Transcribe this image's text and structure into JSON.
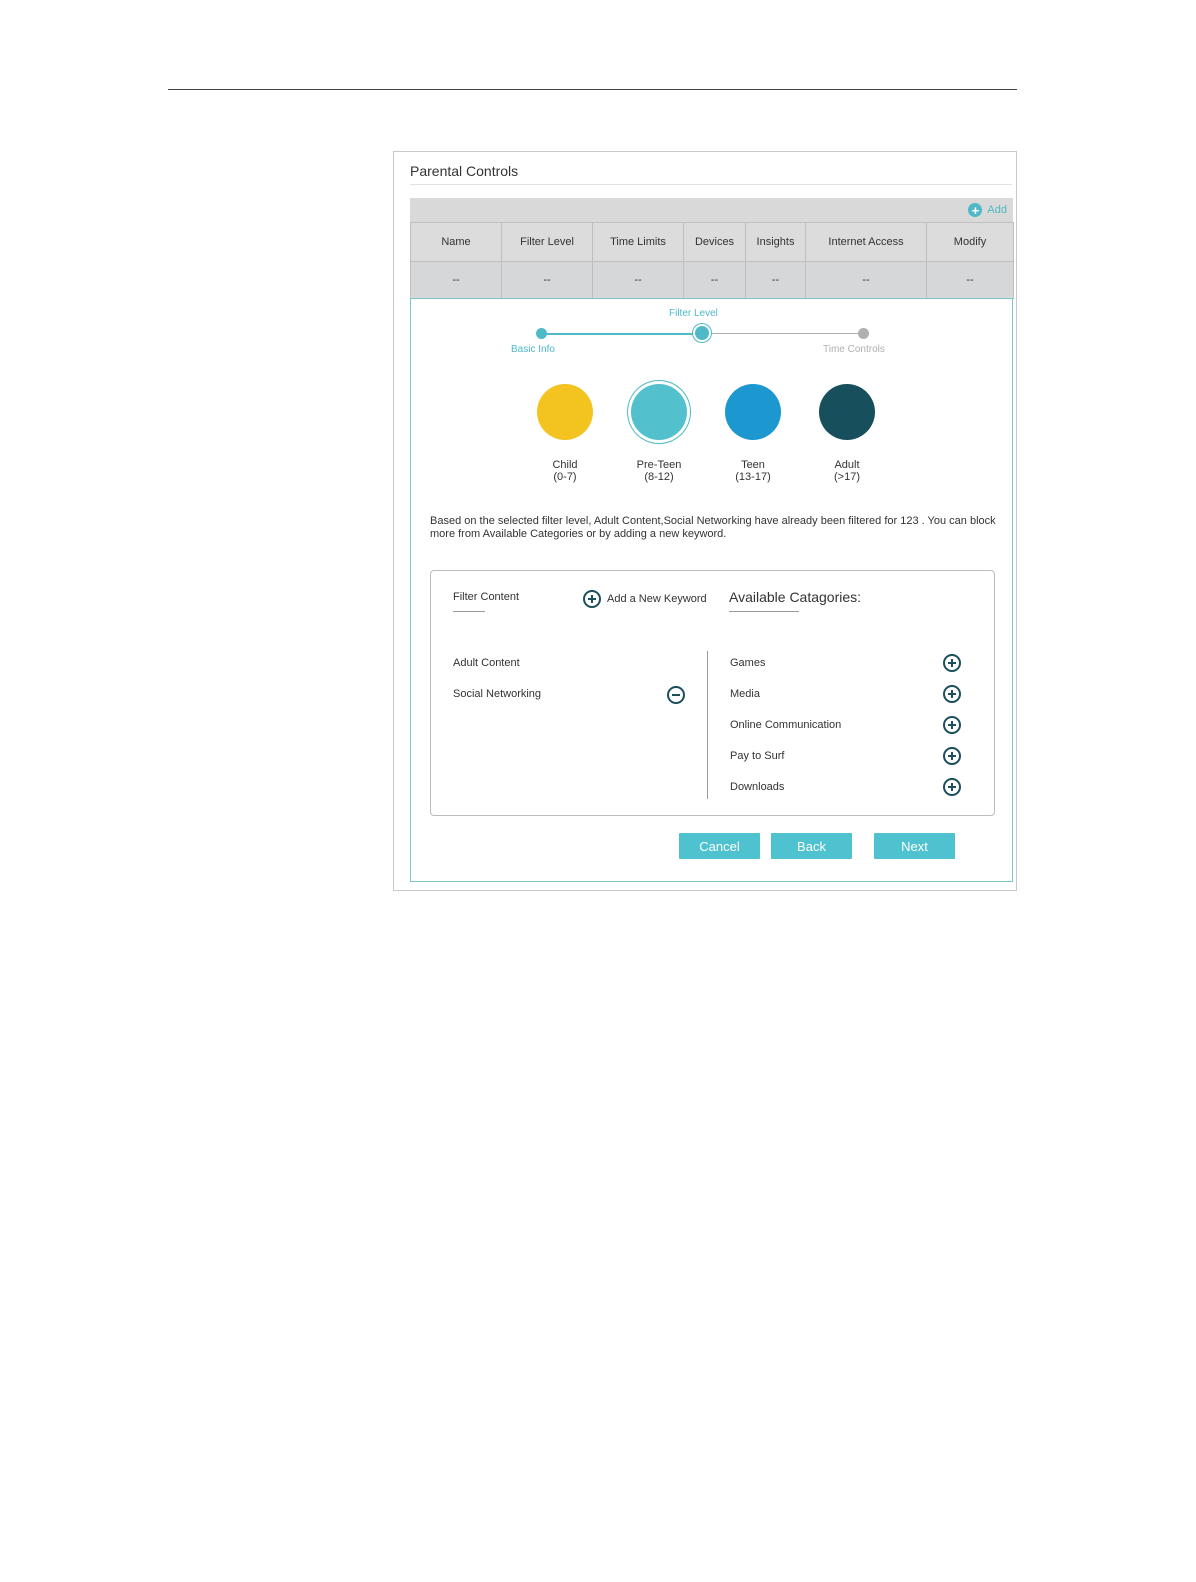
{
  "panel": {
    "title": "Parental Controls",
    "add_label": "Add"
  },
  "table": {
    "headers": [
      "Name",
      "Filter Level",
      "Time Limits",
      "Devices",
      "Insights",
      "Internet Access",
      "Modify"
    ],
    "row": [
      "--",
      "--",
      "--",
      "--",
      "--",
      "--",
      "--"
    ]
  },
  "stepper": {
    "basic": "Basic Info",
    "filter": "Filter Level",
    "time": "Time Controls"
  },
  "levels": [
    {
      "name": "Child",
      "age": "(0-7)",
      "color": "#f3c31f"
    },
    {
      "name": "Pre-Teen",
      "age": "(8-12)",
      "color": "#52c1cd"
    },
    {
      "name": "Teen",
      "age": "(13-17)",
      "color": "#1c97cf"
    },
    {
      "name": "Adult",
      "age": "(>17)",
      "color": "#174f5c"
    }
  ],
  "selected_level": "Pre-Teen",
  "description": "Based on the selected filter level, Adult Content,Social Networking have already been filtered for 123 . You can block more from Available Categories or by adding a new keyword.",
  "filter": {
    "heading": "Filter Content",
    "add_keyword": "Add a New Keyword",
    "items": [
      "Adult Content",
      "Social Networking"
    ]
  },
  "available": {
    "heading": "Available Catagories:",
    "items": [
      "Games",
      "Media",
      "Online Communication",
      "Pay to Surf",
      "Downloads"
    ]
  },
  "buttons": {
    "cancel": "Cancel",
    "back": "Back",
    "next": "Next"
  },
  "colors": {
    "accent": "#4fb9c8",
    "icon_dark": "#1b4f5c"
  }
}
